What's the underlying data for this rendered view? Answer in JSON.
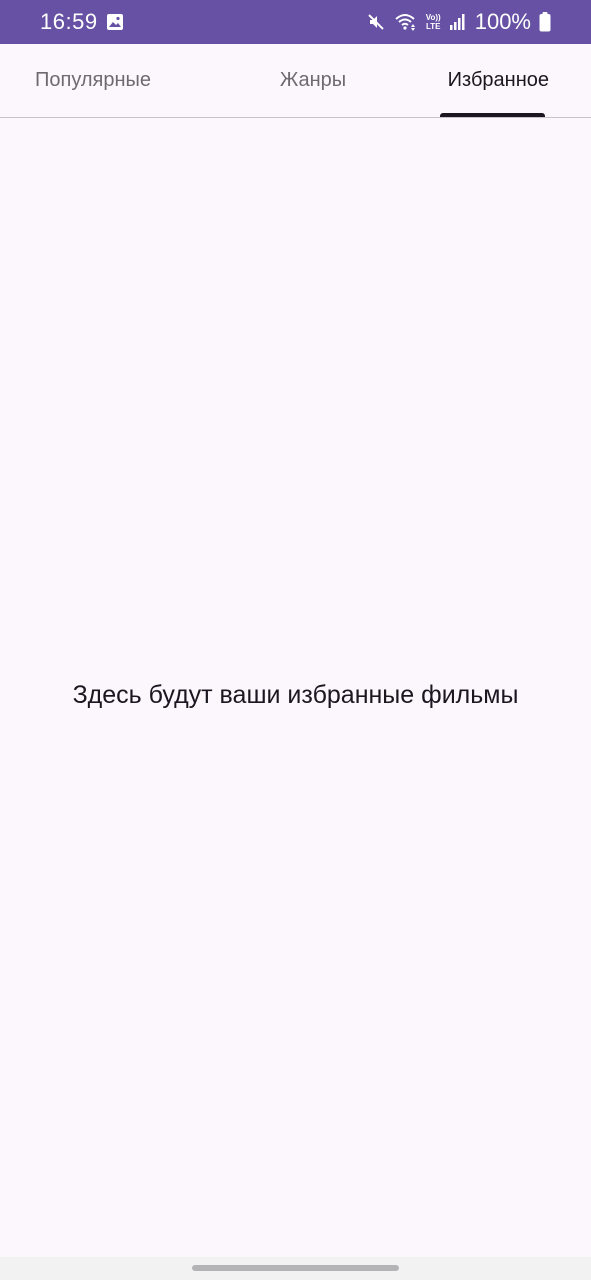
{
  "status_bar": {
    "time": "16:59",
    "battery": "100%",
    "lte_top": "Vo))",
    "lte_bottom": "LTE",
    "background": "#6651a4",
    "icons": [
      "gallery-icon",
      "mute-icon",
      "wifi-icon",
      "volte-icon",
      "signal-icon",
      "battery-icon"
    ]
  },
  "tabs": [
    {
      "label": "Популярные",
      "active": false
    },
    {
      "label": "Жанры",
      "active": false
    },
    {
      "label": "Избранное",
      "active": true
    }
  ],
  "main": {
    "empty_message": "Здесь будут ваши избранные фильмы"
  },
  "colors": {
    "background": "#fcf6fd",
    "text_primary": "#1a1720",
    "text_inactive": "#6f6a72"
  }
}
